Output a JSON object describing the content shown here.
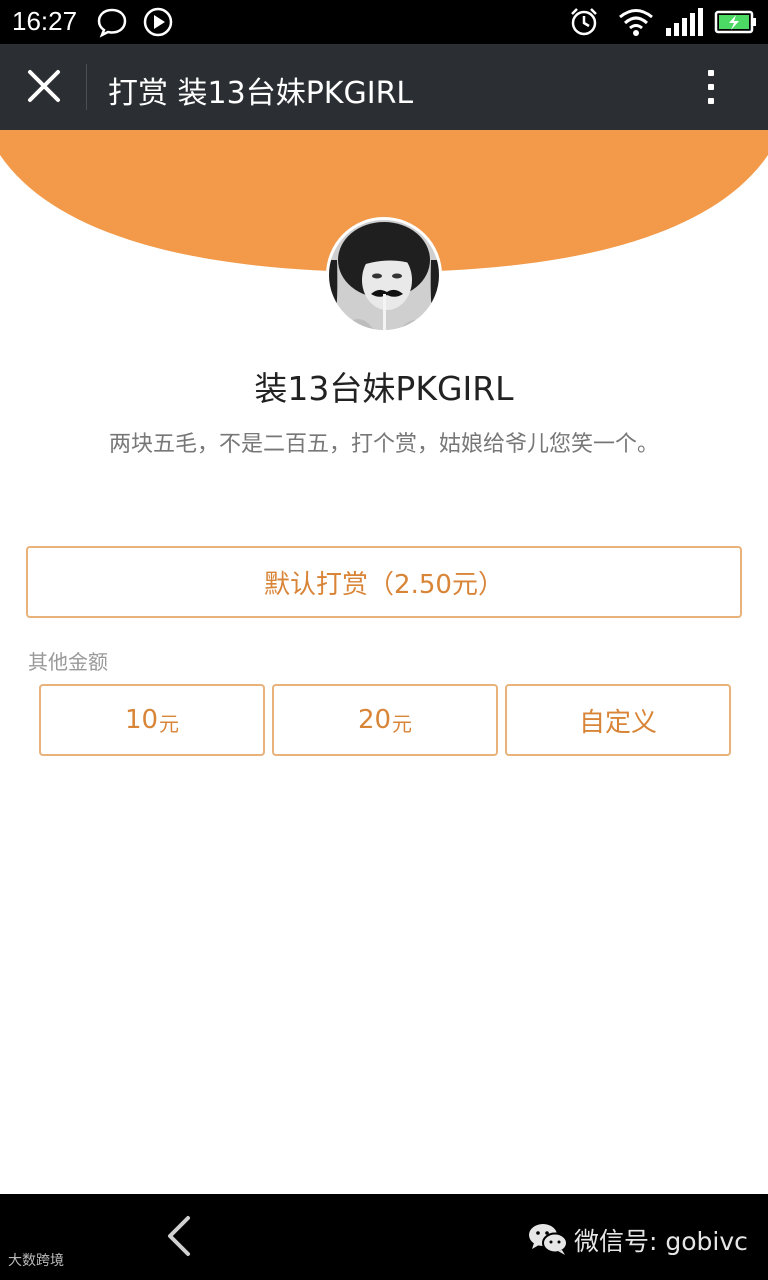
{
  "status_bar": {
    "time": "16:27",
    "icons": [
      "chat-bubble-icon",
      "media-play-icon",
      "alarm-icon",
      "wifi-icon",
      "signal-icon",
      "battery-charging-icon"
    ]
  },
  "title_bar": {
    "title": "打赏 装13台妹PKGIRL",
    "close_icon": "close-icon",
    "more_icon": "more-vertical-icon"
  },
  "profile": {
    "name": "装13台妹PKGIRL",
    "description": "两块五毛，不是二百五，打个赏，姑娘给爷儿您笑一个。"
  },
  "reward": {
    "default_label": "默认打赏（2.50元）",
    "other_label": "其他金额",
    "options": [
      {
        "amount": "10",
        "unit": "元"
      },
      {
        "amount": "20",
        "unit": "元"
      },
      {
        "amount": "自定义",
        "unit": ""
      }
    ]
  },
  "bottom_bar": {
    "watermark_left": "大数跨境",
    "wechat_text": "微信号: gobivc"
  },
  "colors": {
    "accent_orange": "#f29a49",
    "button_border": "#e8b27a",
    "button_text": "#d98538",
    "title_bar_bg": "#2b2f33"
  }
}
